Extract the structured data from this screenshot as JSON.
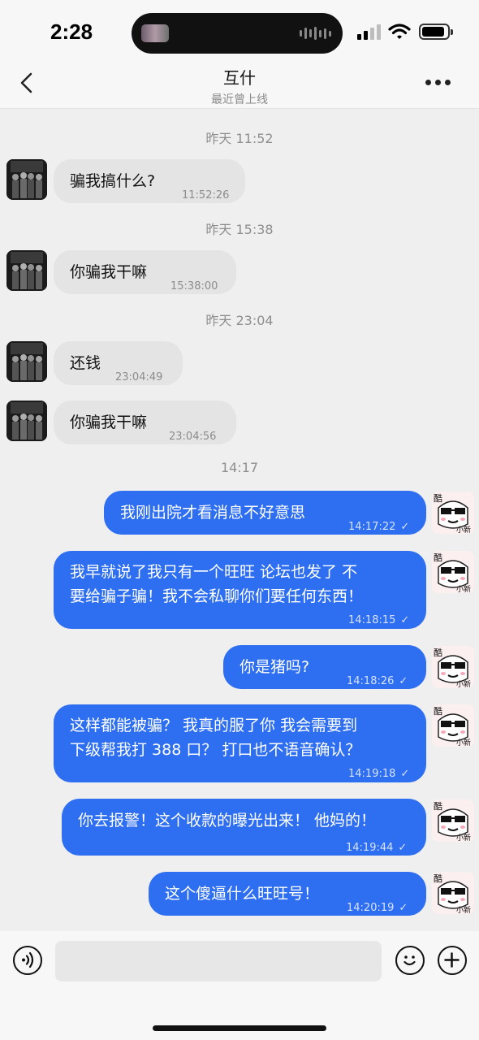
{
  "status_bar": {
    "time": "2:28"
  },
  "header": {
    "title": "互什",
    "subtitle": "最近曾上线"
  },
  "messages": [
    {
      "type": "time",
      "text": "昨天 11:52"
    },
    {
      "type": "in",
      "text": "骗我搞什么?",
      "time": "11:52:26"
    },
    {
      "type": "time",
      "text": "昨天 15:38"
    },
    {
      "type": "in",
      "text": "你骗我干嘛",
      "time": "15:38:00"
    },
    {
      "type": "time",
      "text": "昨天 23:04"
    },
    {
      "type": "in",
      "text": "还钱",
      "time": "23:04:49"
    },
    {
      "type": "in",
      "text": "你骗我干嘛",
      "time": "23:04:56"
    },
    {
      "type": "time",
      "text": "14:17"
    },
    {
      "type": "out",
      "text": "我刚出院才看消息不好意思",
      "time": "14:17:22"
    },
    {
      "type": "out",
      "lines": [
        "我早就说了我只有一个旺旺 论坛也发了 不",
        "要给骗子骗！我不会私聊你们要任何东西！"
      ],
      "time": "14:18:15"
    },
    {
      "type": "out",
      "text": "你是猪吗?",
      "time": "14:18:26"
    },
    {
      "type": "out",
      "lines": [
        "这样都能被骗？ 我真的服了你 我会需要到",
        "下级帮我打 388 口？ 打口也不语音确认？"
      ],
      "time": "14:19:18"
    },
    {
      "type": "out",
      "text": "你去报警！这个收款的曝光出来！ 他妈的！",
      "time": "14:19:44"
    },
    {
      "type": "out",
      "text": "这个傻逼什么旺旺号！",
      "time": "14:20:19"
    }
  ],
  "read_mark": "✓",
  "avatar_right_text": {
    "top": "酷",
    "bottom": "小新"
  },
  "input": {
    "placeholder": ""
  },
  "icons": {
    "back": "chevron-left-icon",
    "more": "more-dots-icon",
    "voice": "voice-icon",
    "emoji": "emoji-icon",
    "plus": "plus-icon"
  },
  "colors": {
    "outgoing_bubble": "#2e6ef0",
    "incoming_bubble": "#e4e4e4",
    "background": "#efefef"
  }
}
